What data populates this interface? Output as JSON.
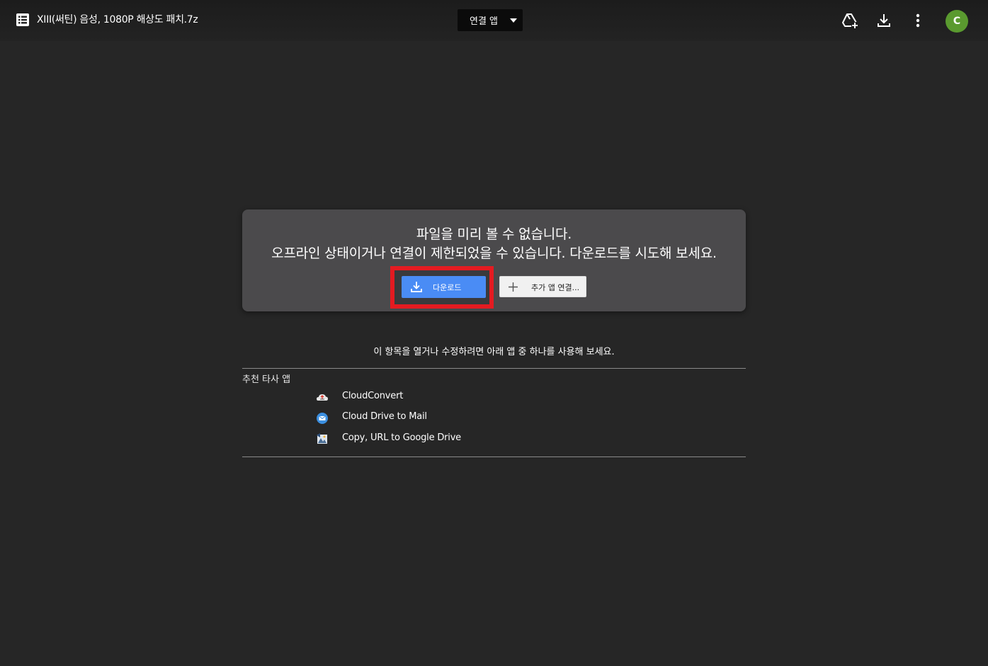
{
  "header": {
    "file_title": "XIII(써틴) 음성, 1080P 해상도 패치.7z",
    "open_with_label": "연결 앱",
    "avatar_letter": "C"
  },
  "icons": {
    "file_type": "archive-list-icon",
    "add_to_drive": "add-to-drive-icon",
    "download": "download-icon",
    "more": "more-vert-icon",
    "dropdown": "caret-down-icon"
  },
  "card": {
    "message_line1": "파일을 미리 볼 수 없습니다.",
    "message_line2": "오프라인 상태이거나 연결이 제한되었을 수 있습니다. 다운로드를 시도해 보세요.",
    "download_label": "다운로드",
    "more_apps_label": "추가 앱 연결..."
  },
  "suggestions": {
    "hint": "이 항목을 열거나 수정하려면 아래 앱 중 하나를 사용해 보세요.",
    "section_title": "추천 타사 앱",
    "apps": [
      {
        "name": "CloudConvert",
        "icon": "cloudconvert-icon"
      },
      {
        "name": "Cloud Drive to Mail",
        "icon": "mail-icon"
      },
      {
        "name": "Copy, URL to Google Drive",
        "icon": "url-to-drive-icon"
      }
    ]
  },
  "colors": {
    "background": "#262626",
    "card": "#4b4a4c",
    "primary_button": "#4a8cf5",
    "highlight": "#e41b21",
    "avatar": "#5a9a2f"
  }
}
